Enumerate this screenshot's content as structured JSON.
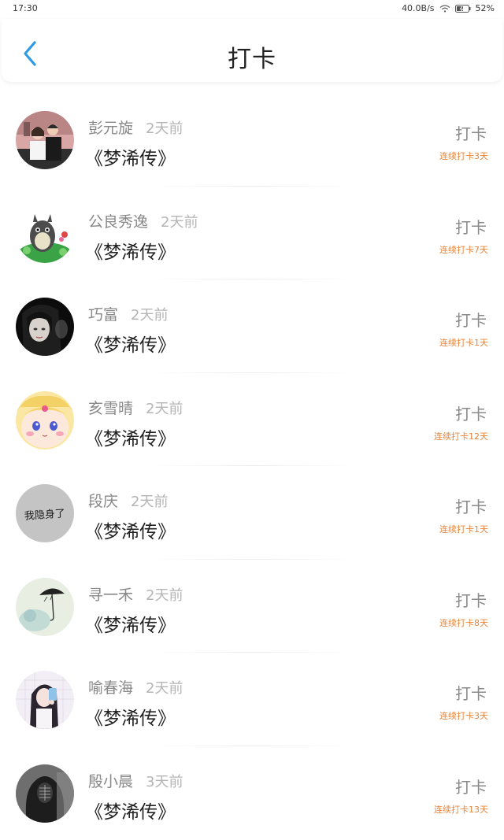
{
  "status_bar": {
    "time": "17:30",
    "network_speed": "40.0B/s",
    "battery": "52%",
    "icons": [
      "wifi-icon",
      "battery-icon"
    ]
  },
  "header": {
    "title": "打卡",
    "back_icon": "chevron-left-icon",
    "accent_color": "#2d9be6"
  },
  "entries": [
    {
      "name": "彭元旋",
      "time": "2天前",
      "book": "《梦浠传》",
      "action": "打卡",
      "streak": "连续打卡3天",
      "avatar": "avatar-couple-photo"
    },
    {
      "name": "公良秀逸",
      "time": "2天前",
      "book": "《梦浠传》",
      "action": "打卡",
      "streak": "连续打卡7天",
      "avatar": "avatar-totoro"
    },
    {
      "name": "巧富",
      "time": "2天前",
      "book": "《梦浠传》",
      "action": "打卡",
      "streak": "连续打卡1天",
      "avatar": "avatar-dark-portrait"
    },
    {
      "name": "亥雪晴",
      "time": "2天前",
      "book": "《梦浠传》",
      "action": "打卡",
      "streak": "连续打卡12天",
      "avatar": "avatar-cartoon-girl"
    },
    {
      "name": "段庆",
      "time": "2天前",
      "book": "《梦浠传》",
      "action": "打卡",
      "streak": "连续打卡1天",
      "avatar": "avatar-text"
    },
    {
      "name": "寻一禾",
      "time": "2天前",
      "book": "《梦浠传》",
      "action": "打卡",
      "streak": "连续打卡8天",
      "avatar": "avatar-umbrella"
    },
    {
      "name": "喻春海",
      "time": "2天前",
      "book": "《梦浠传》",
      "action": "打卡",
      "streak": "连续打卡3天",
      "avatar": "avatar-selfie"
    },
    {
      "name": "殷小晨",
      "time": "3天前",
      "book": "《梦浠传》",
      "action": "打卡",
      "streak": "连续打卡13天",
      "avatar": "avatar-hooded-figure"
    }
  ],
  "avatar_text": "我隐身了",
  "colors": {
    "name": "#888888",
    "time": "#b5b5b5",
    "book": "#222222",
    "streak": "#e8843a"
  }
}
